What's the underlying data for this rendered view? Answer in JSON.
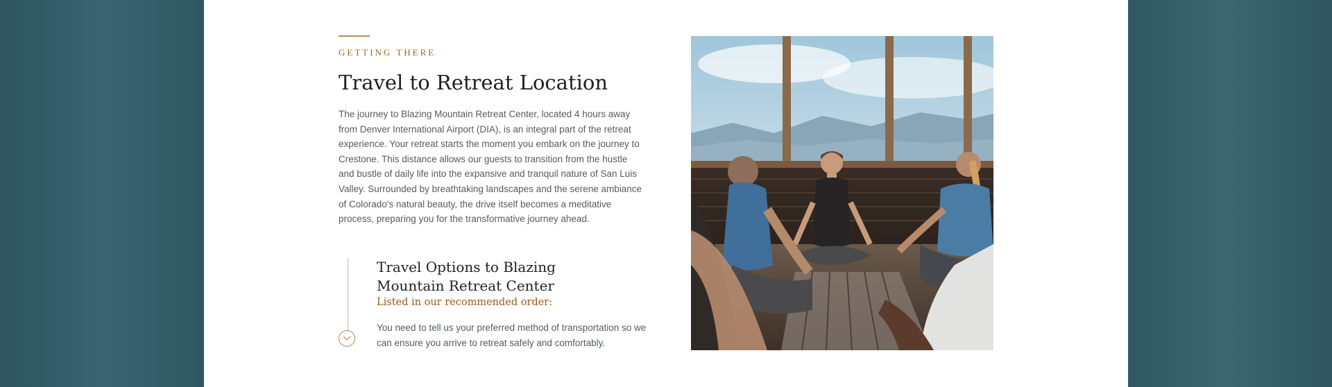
{
  "section": {
    "eyebrow": "GETTING THERE",
    "title": "Travel to Retreat Location",
    "paragraph": "The journey to Blazing Mountain Retreat Center, located 4 hours away from Denver International Airport (DIA), is an integral part of the retreat experience. Your retreat starts the moment you embark on the journey to Crestone.   This distance allows our guests to transition from the hustle and bustle of daily life into the expansive and tranquil nature of San Luis Valley. Surrounded by breathtaking landscapes and the serene ambiance of Colorado's natural beauty, the drive itself becomes a meditative process, preparing you for the transformative journey ahead."
  },
  "travel_options": {
    "title": "Travel Options to Blazing Mountain Retreat Center",
    "tagline": "Listed in our recommended order:",
    "description": "You need to tell us your preferred method of transportation so we can ensure you arrive to retreat safely and comfortably."
  },
  "icons": {
    "expand": "chevron-down-icon"
  },
  "colors": {
    "accent": "#a5651f",
    "background": "#2f5862",
    "panel": "#ffffff"
  }
}
